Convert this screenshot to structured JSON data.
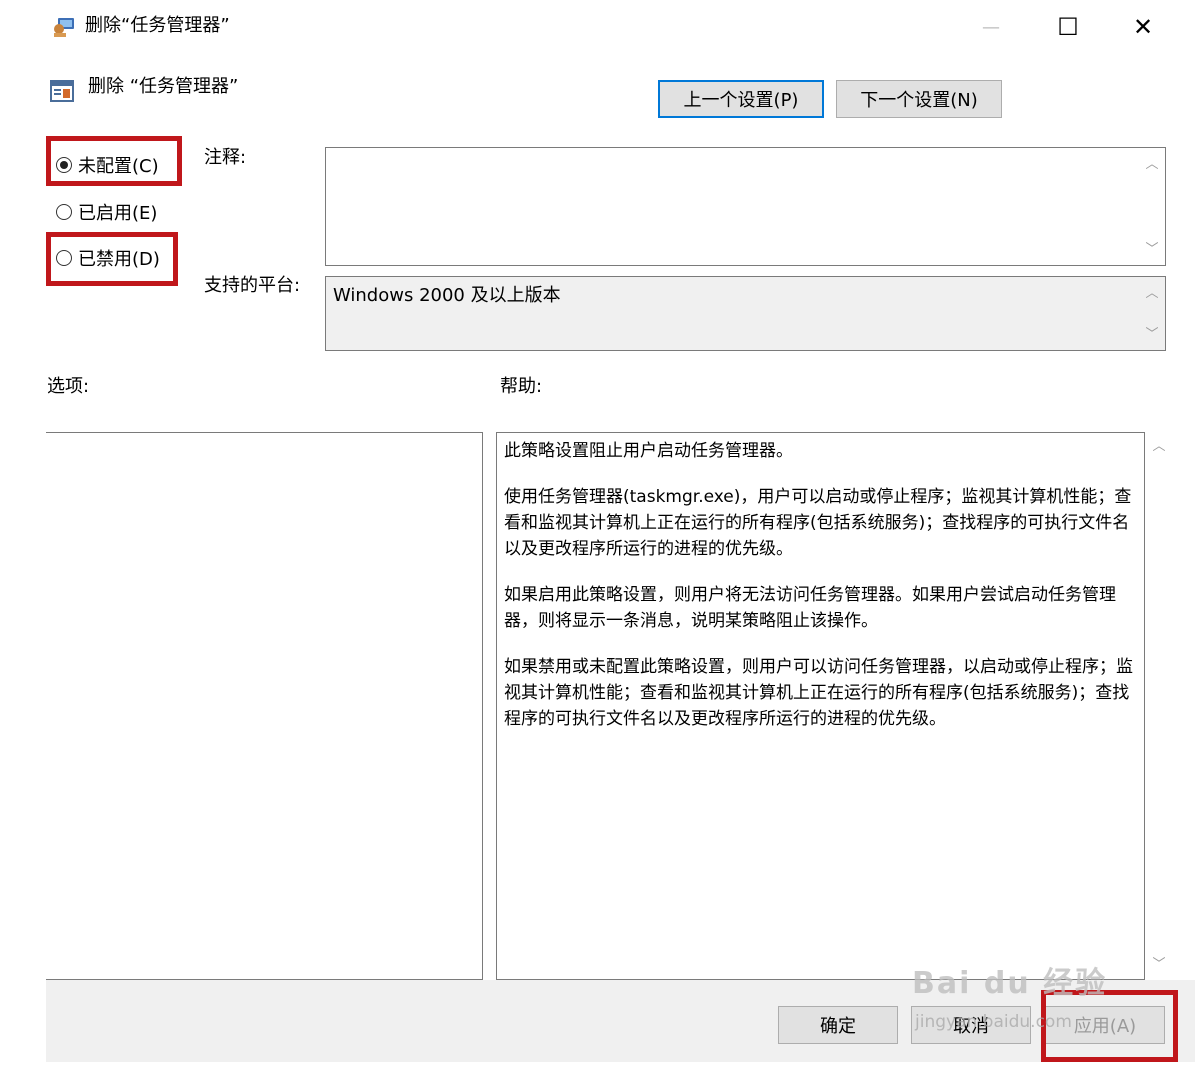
{
  "window": {
    "title": "删除“任务管理器”",
    "controls": {
      "minimize": "—",
      "maximize": "☐",
      "close": "✕"
    }
  },
  "header": {
    "policy_name": "删除 “任务管理器”",
    "prev_button": "上一个设置(P)",
    "next_button": "下一个设置(N)"
  },
  "state": {
    "options": [
      {
        "label": "未配置(C)",
        "selected": true
      },
      {
        "label": "已启用(E)",
        "selected": false
      },
      {
        "label": "已禁用(D)",
        "selected": false
      }
    ]
  },
  "comment": {
    "label": "注释:",
    "value": ""
  },
  "platform": {
    "label": "支持的平台:",
    "value": "Windows 2000 及以上版本"
  },
  "options_panel": {
    "label": "选项:"
  },
  "help_panel": {
    "label": "帮助:",
    "paragraphs": [
      "此策略设置阻止用户启动任务管理器。",
      "使用任务管理器(taskmgr.exe)，用户可以启动或停止程序；监视其计算机性能；查看和监视其计算机上正在运行的所有程序(包括系统服务)；查找程序的可执行文件名以及更改程序所运行的进程的优先级。",
      "如果启用此策略设置，则用户将无法访问任务管理器。如果用户尝试启动任务管理器，则将显示一条消息，说明某策略阻止该操作。",
      "如果禁用或未配置此策略设置，则用户可以访问任务管理器，以启动或停止程序；监视其计算机性能；查看和监视其计算机上正在运行的所有程序(包括系统服务)；查找程序的可执行文件名以及更改程序所运行的进程的优先级。"
    ]
  },
  "footer": {
    "ok": "确定",
    "cancel": "取消",
    "apply": "应用(A)"
  },
  "watermark": {
    "brand": "Bai du 经验",
    "url": "jingyan.baidu.com"
  },
  "colors": {
    "highlight_red": "#c0171b",
    "focus_blue": "#0078d7"
  }
}
